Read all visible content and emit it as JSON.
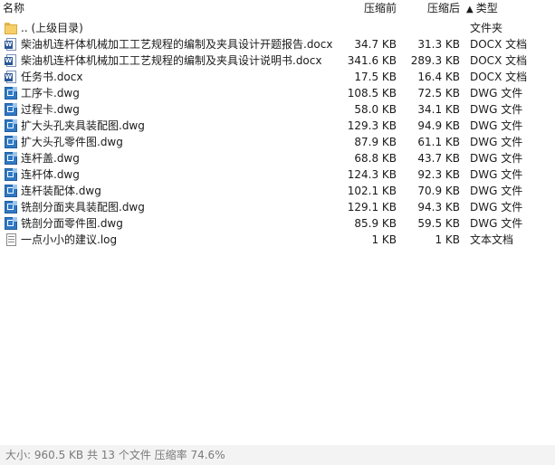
{
  "header": {
    "name": "名称",
    "size": "压缩前",
    "packed": "压缩后",
    "type": "类型",
    "sort_arrow": "▲"
  },
  "files": [
    {
      "name": ".. (上级目录)",
      "size": "",
      "packed": "",
      "type": "文件夹",
      "icon": "folder-icon"
    },
    {
      "name": "柴油机连杆体机械加工工艺规程的编制及夹具设计开题报告.docx",
      "size": "34.7 KB",
      "packed": "31.3 KB",
      "type": "DOCX 文档",
      "icon": "docx-icon"
    },
    {
      "name": "柴油机连杆体机械加工工艺规程的编制及夹具设计说明书.docx",
      "size": "341.6 KB",
      "packed": "289.3 KB",
      "type": "DOCX 文档",
      "icon": "docx-icon"
    },
    {
      "name": "任务书.docx",
      "size": "17.5 KB",
      "packed": "16.4 KB",
      "type": "DOCX 文档",
      "icon": "docx-icon"
    },
    {
      "name": "工序卡.dwg",
      "size": "108.5 KB",
      "packed": "72.5 KB",
      "type": "DWG 文件",
      "icon": "dwg-icon"
    },
    {
      "name": "过程卡.dwg",
      "size": "58.0 KB",
      "packed": "34.1 KB",
      "type": "DWG 文件",
      "icon": "dwg-icon"
    },
    {
      "name": "扩大头孔夹具装配图.dwg",
      "size": "129.3 KB",
      "packed": "94.9 KB",
      "type": "DWG 文件",
      "icon": "dwg-icon"
    },
    {
      "name": "扩大头孔零件图.dwg",
      "size": "87.9 KB",
      "packed": "61.1 KB",
      "type": "DWG 文件",
      "icon": "dwg-icon"
    },
    {
      "name": "连杆盖.dwg",
      "size": "68.8 KB",
      "packed": "43.7 KB",
      "type": "DWG 文件",
      "icon": "dwg-icon"
    },
    {
      "name": "连杆体.dwg",
      "size": "124.3 KB",
      "packed": "92.3 KB",
      "type": "DWG 文件",
      "icon": "dwg-icon"
    },
    {
      "name": "连杆装配体.dwg",
      "size": "102.1 KB",
      "packed": "70.9 KB",
      "type": "DWG 文件",
      "icon": "dwg-icon"
    },
    {
      "name": "铣剖分面夹具装配图.dwg",
      "size": "129.1 KB",
      "packed": "94.3 KB",
      "type": "DWG 文件",
      "icon": "dwg-icon"
    },
    {
      "name": "铣剖分面零件图.dwg",
      "size": "85.9 KB",
      "packed": "59.5 KB",
      "type": "DWG 文件",
      "icon": "dwg-icon"
    },
    {
      "name": "一点小小的建议.log",
      "size": "1 KB",
      "packed": "1 KB",
      "type": "文本文档",
      "icon": "log-icon"
    }
  ],
  "status": {
    "text": "大小: 960.5 KB 共 13 个文件 压缩率 74.6%"
  }
}
